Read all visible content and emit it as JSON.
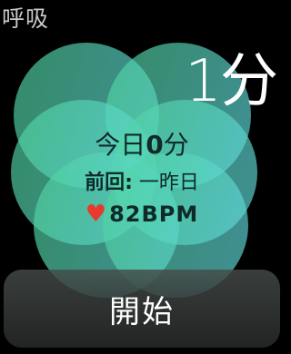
{
  "app": {
    "title": "呼吸"
  },
  "duration": {
    "value": "1",
    "unit": "分"
  },
  "today": {
    "label": "今日",
    "value": "0",
    "unit": "分"
  },
  "last_session": {
    "label": "前回:",
    "value": "一昨日"
  },
  "heart_rate": {
    "icon": "heart-icon",
    "value": "82BPM",
    "color": "#e8392e"
  },
  "start_button": {
    "label": "開始"
  },
  "colors": {
    "petal_light": "#6fe7d3",
    "petal_dark": "#33b98c",
    "background": "#000000"
  }
}
